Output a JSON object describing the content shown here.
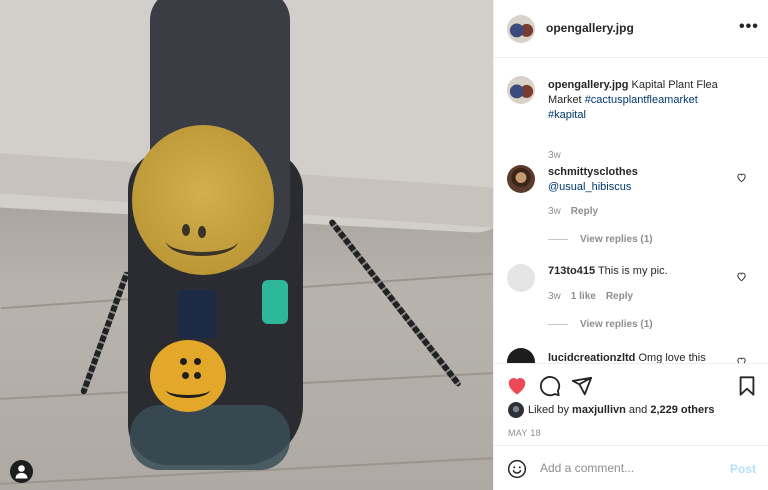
{
  "post": {
    "username": "opengallery.jpg",
    "more_icon": "more-horizontal-icon"
  },
  "caption": {
    "username": "opengallery.jpg",
    "text": "Kapital Plant Flea Market",
    "tags": [
      "#cactusplantfleamarket",
      "#kapital"
    ],
    "time": "3w"
  },
  "comments": [
    {
      "username": "schmittysclothes",
      "text": "@usual_hibiscus",
      "time": "3w",
      "reply": "Reply",
      "likes": "",
      "view_replies": "View replies (1)"
    },
    {
      "username": "713to415",
      "text": "This is my pic.",
      "time": "3w",
      "likes": "1 like",
      "reply": "Reply",
      "view_replies": "View replies (1)"
    },
    {
      "username": "lucidcreationzltd",
      "text": "Omg love this",
      "time": "",
      "reply": "",
      "view_replies": ""
    }
  ],
  "actions": {
    "like_icon": "heart-filled-icon",
    "comment_icon": "comment-icon",
    "share_icon": "share-icon",
    "save_icon": "bookmark-icon",
    "liked_prefix": "Liked by",
    "liked_user": "maxjullivn",
    "liked_and": "and",
    "liked_others": "2,229 others",
    "date": "MAY 18"
  },
  "add_comment": {
    "placeholder": "Add a comment...",
    "post_label": "Post",
    "emoji_icon": "emoji-icon"
  },
  "colors": {
    "like": "#ed4956",
    "link": "#00376b",
    "muted": "#8e8e8e",
    "post_disabled": "#b2dffc"
  }
}
